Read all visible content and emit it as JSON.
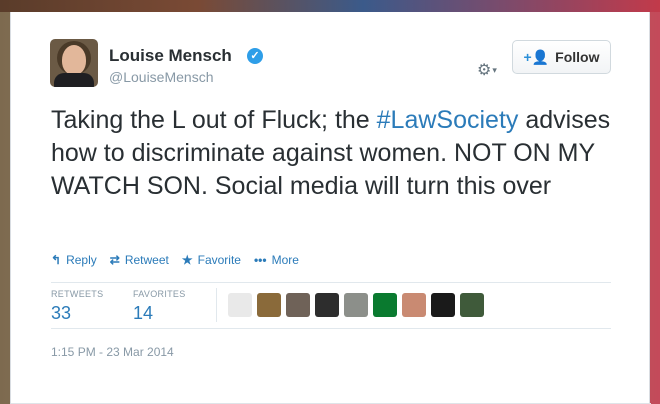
{
  "user": {
    "name": "Louise Mensch",
    "handle": "@LouiseMensch"
  },
  "follow_button": {
    "label": "Follow",
    "icon": "add-user-icon"
  },
  "tweet": {
    "text_before": "Taking the L out of Fluck; the ",
    "hashtag": "#LawSociety",
    "text_after": " advises how to discriminate against women. NOT ON MY WATCH SON. Social media will turn this over"
  },
  "actions": {
    "reply": "Reply",
    "retweet": "Retweet",
    "favorite": "Favorite",
    "more": "More"
  },
  "stats": {
    "retweets_label": "RETWEETS",
    "retweets_value": "33",
    "favorites_label": "FAVORITES",
    "favorites_value": "14"
  },
  "favoriter_avatar_colors": [
    "#e9e9e9",
    "#8a6a3a",
    "#6f6258",
    "#2d2d2d",
    "#8c8f8a",
    "#0a7a2f",
    "#c98a72",
    "#1a1a1a",
    "#3f5a3a"
  ],
  "timestamp": "1:15 PM - 23 Mar 2014",
  "colors": {
    "link": "#2b7bb9",
    "verified": "#2e9ee8",
    "text": "#292f33",
    "muted": "#8899a6"
  }
}
